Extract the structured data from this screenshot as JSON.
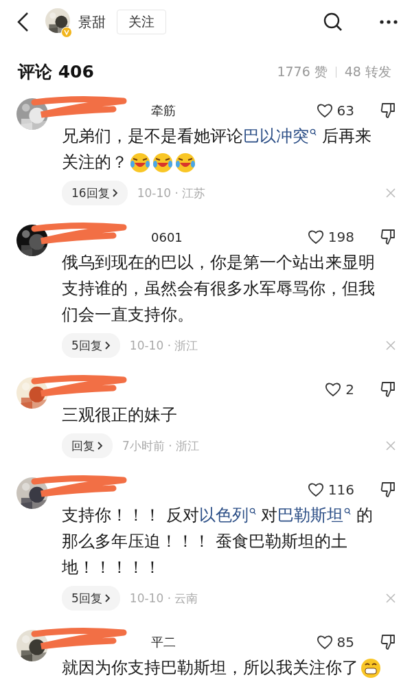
{
  "header": {
    "author": "景甜",
    "follow": "关注"
  },
  "summary": {
    "title": "评论 406",
    "likes": "1776 赞",
    "reposts": "48 转发"
  },
  "comments": [
    {
      "name": "牵筋",
      "likes": "63",
      "body": [
        {
          "kind": "text",
          "text": "兄弟们，是不是看她评论"
        },
        {
          "kind": "link",
          "text": "巴以冲突"
        },
        {
          "kind": "text",
          "text": " 后再来关注的？"
        },
        {
          "kind": "laughing"
        },
        {
          "kind": "laughing"
        },
        {
          "kind": "laughing"
        }
      ],
      "replies": "16回复",
      "meta": "10-10 · 江苏"
    },
    {
      "name": "0601",
      "likes": "198",
      "body": [
        {
          "kind": "text",
          "text": "俄乌到现在的巴以，你是第一个站出来显明支持谁的，虽然会有很多水军辱骂你，但我们会一直支持你。"
        }
      ],
      "replies": "5回复",
      "meta": "10-10 · 浙江"
    },
    {
      "likes": "2",
      "body": [
        {
          "kind": "text",
          "text": "三观很正的妹子"
        }
      ],
      "replies": "回复",
      "meta": "7小时前 · 浙江"
    },
    {
      "likes": "116",
      "body": [
        {
          "kind": "text",
          "text": "支持你！！！ 反对"
        },
        {
          "kind": "link",
          "text": "以色列"
        },
        {
          "kind": "text",
          "text": " 对"
        },
        {
          "kind": "link",
          "text": "巴勒斯坦"
        },
        {
          "kind": "text",
          "text": " 的那么多年压迫！！！ 蚕食巴勒斯坦的土地！！！！！"
        }
      ],
      "replies": "5回复",
      "meta": "10-10 · 云南"
    },
    {
      "name": "平二",
      "likes": "85",
      "body": [
        {
          "kind": "text",
          "text": "就因为你支持巴勒斯坦，所以我关注你了"
        },
        {
          "kind": "grinning"
        }
      ]
    }
  ]
}
